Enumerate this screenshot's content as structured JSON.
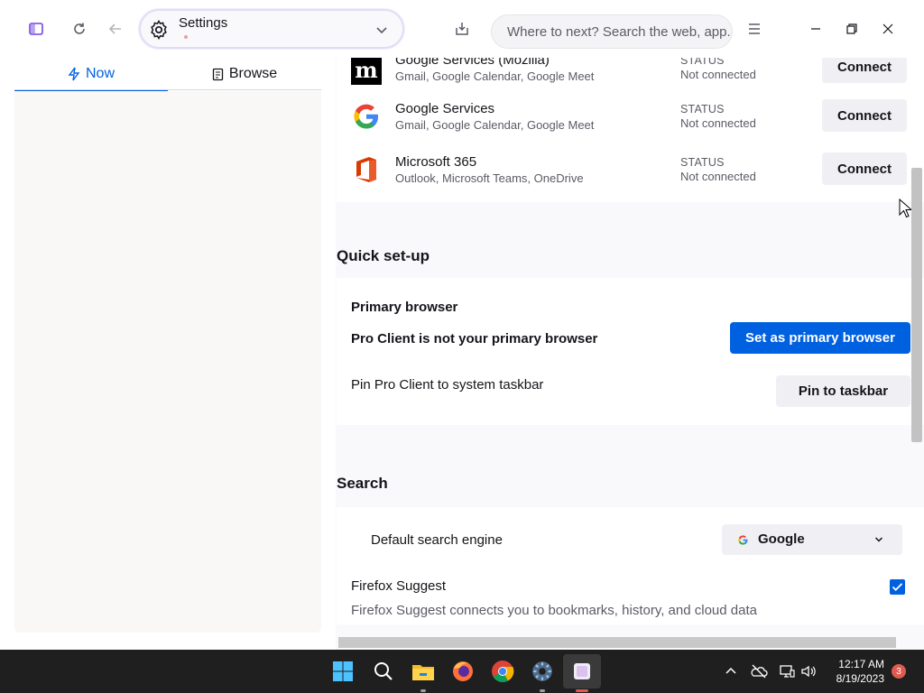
{
  "window": {
    "tab": {
      "title": "Settings"
    },
    "urlbar": {
      "placeholder": "Where to next? Search the web, app..."
    }
  },
  "sidebar": {
    "tabs": [
      {
        "label": "Now",
        "icon": "lightning-icon"
      },
      {
        "label": "Browse",
        "icon": "document-icon"
      }
    ]
  },
  "services": [
    {
      "name": "Google Services (Mozilla)",
      "desc": "Gmail, Google Calendar, Google Meet",
      "status_label": "STATUS",
      "status": "Not connected",
      "action": "Connect"
    },
    {
      "name": "Google Services",
      "desc": "Gmail, Google Calendar, Google Meet",
      "status_label": "STATUS",
      "status": "Not connected",
      "action": "Connect"
    },
    {
      "name": "Microsoft 365",
      "desc": "Outlook, Microsoft Teams, OneDrive",
      "status_label": "STATUS",
      "status": "Not connected",
      "action": "Connect"
    }
  ],
  "quick_setup": {
    "heading": "Quick set-up",
    "primary_title": "Primary browser",
    "primary_message": "Pro Client is not your primary browser",
    "primary_button": "Set as primary browser",
    "pin_label": "Pin Pro Client to system taskbar",
    "pin_button": "Pin to taskbar"
  },
  "search": {
    "heading": "Search",
    "engine_label": "Default search engine",
    "engine_value": "Google",
    "suggest_title": "Firefox Suggest",
    "suggest_desc": "Firefox Suggest connects you to bookmarks, history, and cloud data",
    "suggest_checked": true
  },
  "taskbar": {
    "time": "12:17 AM",
    "date": "8/19/2023",
    "notifications": "3"
  },
  "colors": {
    "accent": "#0061e0",
    "google_blue": "#4285f4",
    "google_red": "#ea4335",
    "google_yellow": "#fbbc05",
    "google_green": "#34a853",
    "office_red": "#d83b01",
    "taskbar_bg": "#1f1f1f"
  }
}
